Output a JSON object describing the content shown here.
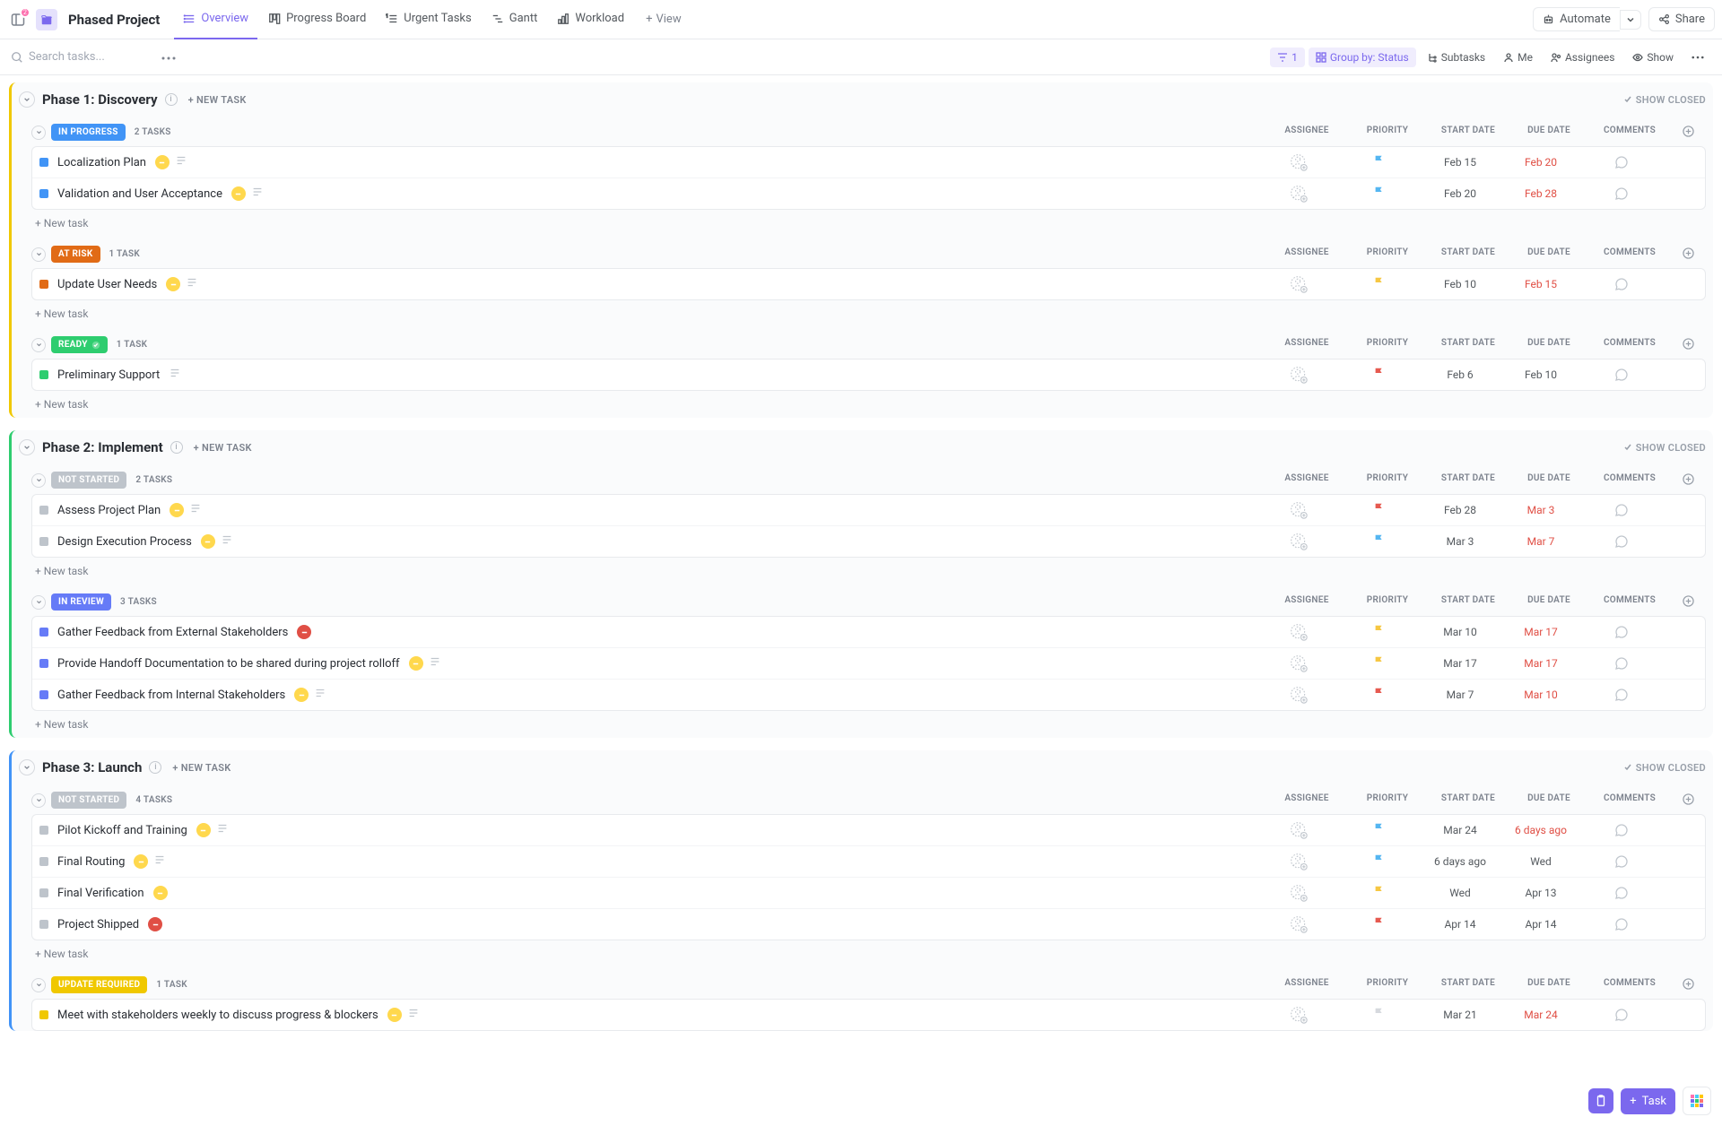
{
  "project_title": "Phased Project",
  "tabs": [
    {
      "label": "Overview",
      "active": true
    },
    {
      "label": "Progress Board"
    },
    {
      "label": "Urgent Tasks"
    },
    {
      "label": "Gantt"
    },
    {
      "label": "Workload"
    }
  ],
  "add_view": "View",
  "automate": "Automate",
  "share": "Share",
  "search_placeholder": "Search tasks...",
  "filter_chips": {
    "count": "1",
    "group_by": "Group by: Status",
    "subtasks": "Subtasks",
    "me": "Me",
    "assignees": "Assignees",
    "show": "Show"
  },
  "show_closed": "SHOW CLOSED",
  "new_task_link": "+ NEW TASK",
  "new_task_row": "+ New task",
  "cols": [
    "ASSIGNEE",
    "PRIORITY",
    "START DATE",
    "DUE DATE",
    "COMMENTS"
  ],
  "phases": [
    {
      "title": "Phase 1: Discovery",
      "color": "ph-yellow",
      "groups": [
        {
          "status": "IN PROGRESS",
          "pill": "pill-in-progress",
          "count": "2 TASKS",
          "tasks": [
            {
              "sq": "sq-blue",
              "title": "Localization Plan",
              "mbadge": "mb-yellow",
              "doc": true,
              "flag": "flag-blue",
              "start": "Feb 15",
              "due": "Feb 20",
              "due_red": true
            },
            {
              "sq": "sq-blue",
              "title": "Validation and User Acceptance",
              "mbadge": "mb-yellow",
              "doc": true,
              "flag": "flag-blue",
              "start": "Feb 20",
              "due": "Feb 28",
              "due_red": true
            }
          ]
        },
        {
          "status": "AT RISK",
          "pill": "pill-at-risk",
          "count": "1 TASK",
          "tasks": [
            {
              "sq": "sq-orange",
              "title": "Update User Needs",
              "mbadge": "mb-yellow",
              "doc": true,
              "flag": "flag-yellow",
              "start": "Feb 10",
              "due": "Feb 15",
              "due_red": true
            }
          ]
        },
        {
          "status": "READY",
          "pill": "pill-ready",
          "check": true,
          "count": "1 TASK",
          "tasks": [
            {
              "sq": "sq-green",
              "title": "Preliminary Support",
              "doc": true,
              "flag": "flag-red",
              "start": "Feb 6",
              "due": "Feb 10"
            }
          ]
        }
      ]
    },
    {
      "title": "Phase 2: Implement",
      "color": "ph-green",
      "groups": [
        {
          "status": "NOT STARTED",
          "pill": "pill-not-started",
          "count": "2 TASKS",
          "tasks": [
            {
              "sq": "sq-grey",
              "title": "Assess Project Plan",
              "mbadge": "mb-yellow",
              "doc": true,
              "flag": "flag-red",
              "start": "Feb 28",
              "due": "Mar 3",
              "due_red": true
            },
            {
              "sq": "sq-grey",
              "title": "Design Execution Process",
              "mbadge": "mb-yellow",
              "doc": true,
              "flag": "flag-blue",
              "start": "Mar 3",
              "due": "Mar 7",
              "due_red": true
            }
          ]
        },
        {
          "status": "IN REVIEW",
          "pill": "pill-in-review",
          "count": "3 TASKS",
          "tasks": [
            {
              "sq": "sq-purple",
              "title": "Gather Feedback from External Stakeholders",
              "mbadge": "mb-red",
              "flag": "flag-yellow",
              "start": "Mar 10",
              "due": "Mar 17",
              "due_red": true
            },
            {
              "sq": "sq-purple",
              "title": "Provide Handoff Documentation to be shared during project rolloff",
              "mbadge": "mb-yellow",
              "doc": true,
              "flag": "flag-yellow",
              "start": "Mar 17",
              "due": "Mar 17",
              "due_red": true
            },
            {
              "sq": "sq-purple",
              "title": "Gather Feedback from Internal Stakeholders",
              "mbadge": "mb-yellow",
              "doc": true,
              "flag": "flag-red",
              "start": "Mar 7",
              "due": "Mar 10",
              "due_red": true
            }
          ]
        }
      ]
    },
    {
      "title": "Phase 3: Launch",
      "color": "ph-blue",
      "groups": [
        {
          "status": "NOT STARTED",
          "pill": "pill-not-started",
          "count": "4 TASKS",
          "tasks": [
            {
              "sq": "sq-grey",
              "title": "Pilot Kickoff and Training",
              "mbadge": "mb-yellow",
              "doc": true,
              "flag": "flag-blue",
              "start": "Mar 24",
              "due": "6 days ago",
              "due_red": true
            },
            {
              "sq": "sq-grey",
              "title": "Final Routing",
              "mbadge": "mb-yellow",
              "doc": true,
              "flag": "flag-blue",
              "start": "6 days ago",
              "due": "Wed"
            },
            {
              "sq": "sq-grey",
              "title": "Final Verification",
              "mbadge": "mb-yellow",
              "flag": "flag-yellow",
              "start": "Wed",
              "due": "Apr 13"
            },
            {
              "sq": "sq-grey",
              "title": "Project Shipped",
              "mbadge": "mb-red",
              "flag": "flag-red",
              "start": "Apr 14",
              "due": "Apr 14"
            }
          ]
        },
        {
          "status": "UPDATE REQUIRED",
          "pill": "pill-update",
          "count": "1 TASK",
          "no_footer": true,
          "tasks": [
            {
              "sq": "sq-yellow",
              "title": "Meet with stakeholders weekly to discuss progress & blockers",
              "mbadge": "mb-yellow",
              "doc": true,
              "flag": "flag-none",
              "start": "Mar 21",
              "due": "Mar 24",
              "due_red": true
            }
          ]
        }
      ]
    }
  ],
  "task_btn": "Task"
}
